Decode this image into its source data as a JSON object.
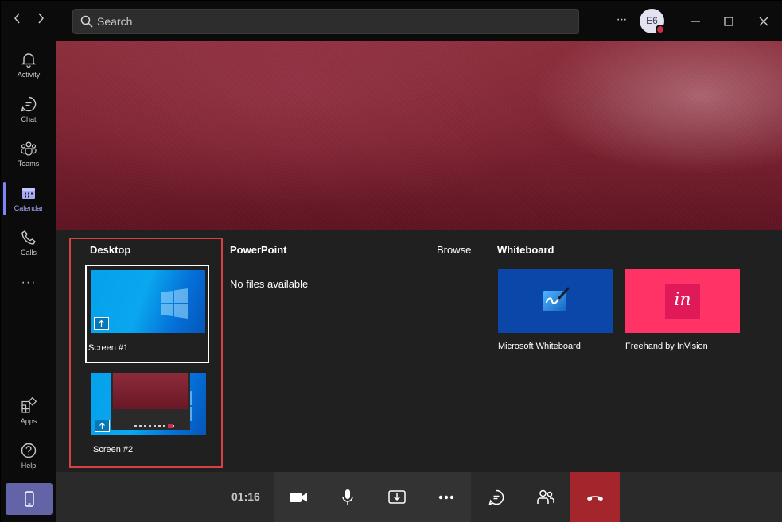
{
  "titlebar": {
    "search_placeholder": "Search",
    "more_label": "···",
    "avatar_initials": "E6",
    "status_color": "#c4314b"
  },
  "rail": {
    "items": [
      {
        "label": "Activity",
        "icon": "bell-icon"
      },
      {
        "label": "Chat",
        "icon": "chat-icon"
      },
      {
        "label": "Teams",
        "icon": "teams-icon"
      },
      {
        "label": "Calendar",
        "icon": "calendar-icon",
        "active": true
      },
      {
        "label": "Calls",
        "icon": "phone-icon"
      }
    ],
    "more_label": "···",
    "bottom_items": [
      {
        "label": "Apps",
        "icon": "apps-icon"
      },
      {
        "label": "Help",
        "icon": "help-icon"
      }
    ]
  },
  "share_tray": {
    "desktop_title": "Desktop",
    "screens": [
      {
        "label": "Screen #1",
        "selected": true
      },
      {
        "label": "Screen #2",
        "selected": false
      }
    ],
    "powerpoint_title": "PowerPoint",
    "powerpoint_empty": "No files available",
    "browse_label": "Browse",
    "whiteboard_title": "Whiteboard",
    "whiteboards": [
      {
        "label": "Microsoft Whiteboard",
        "color": "#0b47a8"
      },
      {
        "label": "Freehand by InVision",
        "color": "#ff3366",
        "logo_text": "in"
      }
    ]
  },
  "call_bar": {
    "timer": "01:16",
    "hangup_color": "#a4262c"
  },
  "colors": {
    "accent": "#6264a7",
    "highlight_border": "#d94045"
  }
}
